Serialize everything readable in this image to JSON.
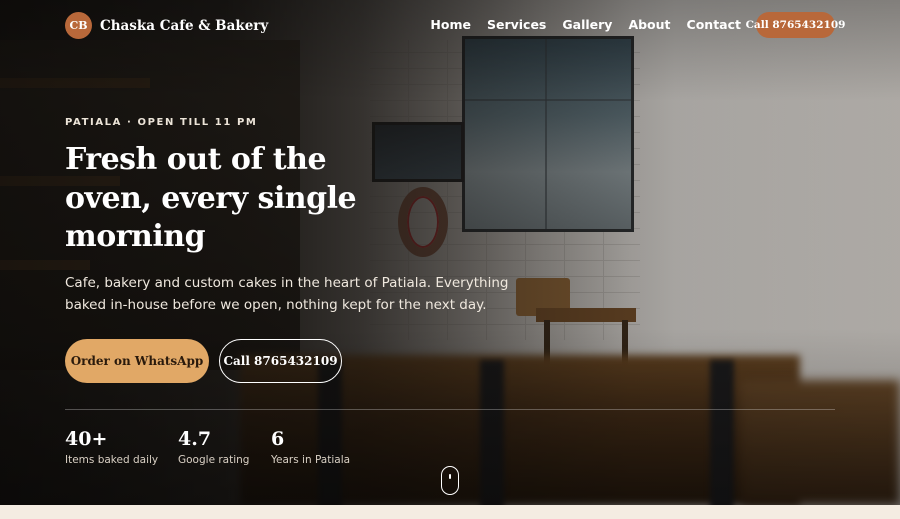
{
  "nav": {
    "brand_initials": "CB",
    "brand_name": "Chaska Cafe & Bakery",
    "links": [
      "Home",
      "Services",
      "Gallery",
      "About",
      "Contact"
    ],
    "call_label": "Call 8765432109"
  },
  "hero": {
    "eyebrow": "PATIALA · OPEN TILL 11 PM",
    "headline": "Fresh out of the oven, every single morning",
    "subcopy": "Cafe, bakery and custom cakes in the heart of Patiala. Everything baked in-house before we open, nothing kept for the next day.",
    "primary_cta": "Order on WhatsApp",
    "secondary_cta": "Call 8765432109"
  },
  "stats": [
    {
      "value": "40+",
      "label": "Items baked daily"
    },
    {
      "value": "4.7",
      "label": "Google rating"
    },
    {
      "value": "6",
      "label": "Years in Patiala"
    }
  ],
  "colors": {
    "accent": "#b8683a",
    "cta": "#e1a866",
    "page_background": "#f4ece2"
  },
  "icons": {
    "scroll_indicator": "mouse-scroll-icon"
  }
}
